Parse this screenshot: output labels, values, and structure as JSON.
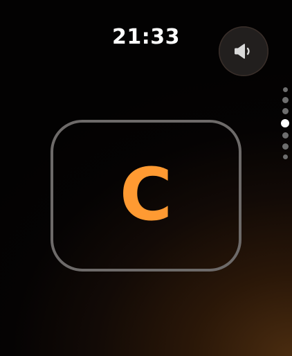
{
  "status": {
    "time": "21:33"
  },
  "controls": {
    "speaker_icon": "speaker-volume-icon"
  },
  "pager": {
    "count": 7,
    "active_index": 3
  },
  "key": {
    "letter": "C",
    "accent_color": "#ff9a32",
    "frame_color": "#6d6a69"
  }
}
